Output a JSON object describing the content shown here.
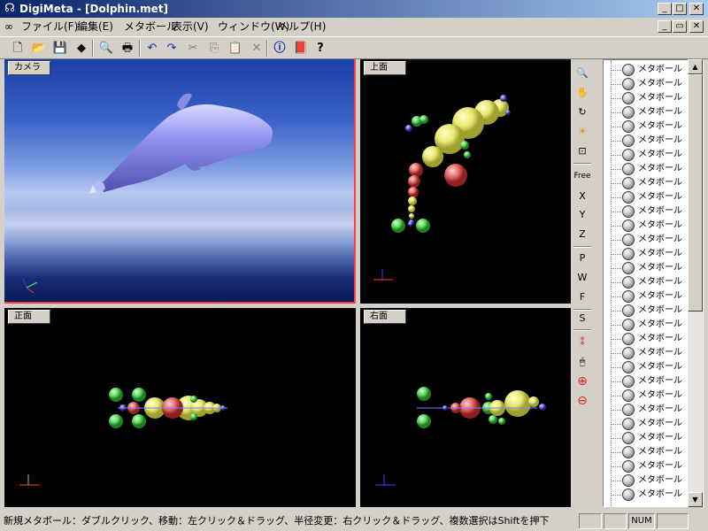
{
  "window": {
    "title": "DigiMeta - [Dolphin.met]",
    "minimize": "_",
    "maximize": "□",
    "close": "✕"
  },
  "menu": {
    "items": [
      "ファイル(F)",
      "編集(E)",
      "メタボール",
      "表示(V)",
      "ウィンドウ(W)",
      "ヘルプ(H)"
    ]
  },
  "toolbar": {
    "icons": [
      "new-icon",
      "open-icon",
      "save-icon",
      "print-setup-icon",
      "print-preview-icon",
      "print-icon",
      "undo-icon",
      "redo-icon",
      "cut-icon",
      "copy-icon",
      "paste-icon",
      "delete-icon",
      "info-icon",
      "book-icon",
      "help-icon"
    ]
  },
  "viewports": {
    "camera": "カメラ",
    "top": "上面",
    "front": "正面",
    "right": "右面"
  },
  "vtoolbar": {
    "free": "Free",
    "x": "X",
    "y": "Y",
    "z": "Z",
    "p": "P",
    "w": "W",
    "f": "F",
    "s": "S"
  },
  "tree": {
    "item_label": "メタボール",
    "count": 31
  },
  "status": {
    "message": "新規メタボール：ダブルクリック、移動：左クリック＆ドラッグ、半径変更：右クリック＆ドラッグ、複数選択はShiftを押下",
    "num": "NUM"
  },
  "colors": {
    "title_gradient_start": "#0a246a",
    "title_gradient_end": "#a6caf0",
    "dolphin": "#8c8cf0",
    "ball_yellow": "#e8e870",
    "ball_green": "#60d860",
    "ball_red": "#e06868",
    "ball_blue": "#7070e0"
  }
}
